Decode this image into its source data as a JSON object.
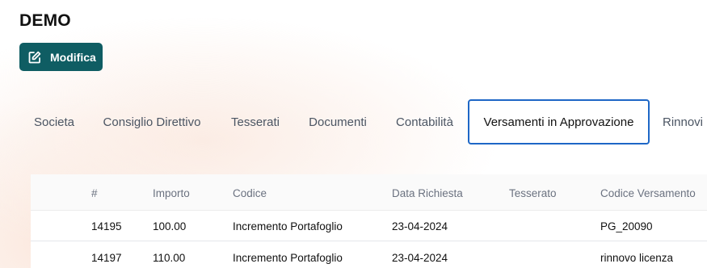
{
  "header": {
    "title": "DEMO",
    "edit_label": "Modifica"
  },
  "tabs": [
    {
      "label": "Societa"
    },
    {
      "label": "Consiglio Direttivo"
    },
    {
      "label": "Tesserati"
    },
    {
      "label": "Documenti"
    },
    {
      "label": "Contabilità"
    },
    {
      "label": "Versamenti in Approvazione",
      "active": true
    },
    {
      "label": "Rinnovi"
    }
  ],
  "table": {
    "columns": [
      "#",
      "Importo",
      "Codice",
      "Data Richiesta",
      "Tesserato",
      "Codice Versamento"
    ],
    "rows": [
      {
        "id": "14195",
        "importo": "100.00",
        "codice": "Incremento Portafoglio",
        "data": "23-04-2024",
        "tesserato": "",
        "codice_versamento": "PG_20090"
      },
      {
        "id": "14197",
        "importo": "110.00",
        "codice": "Incremento Portafoglio",
        "data": "23-04-2024",
        "tesserato": "",
        "codice_versamento": "rinnovo licenza"
      }
    ]
  },
  "colors": {
    "button_bg": "#0f5d63",
    "active_tab_border": "#1e67c6"
  }
}
